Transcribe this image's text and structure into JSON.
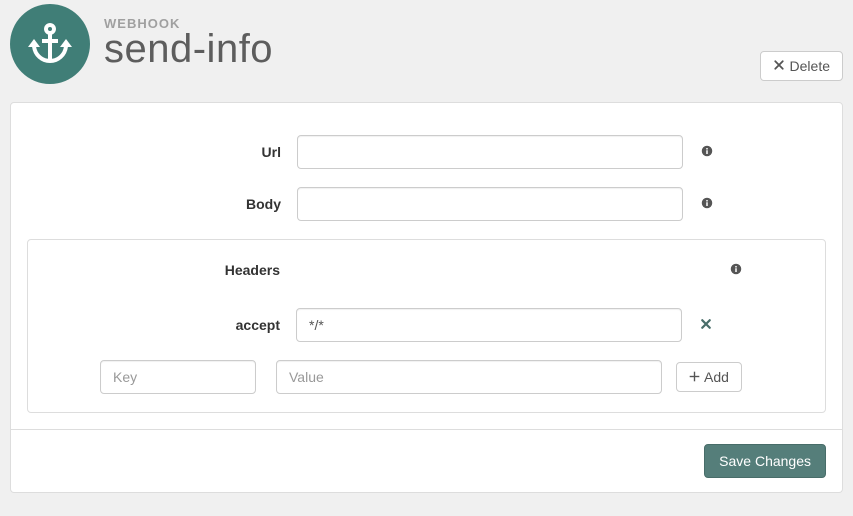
{
  "header": {
    "type_label": "WEBHOOK",
    "title": "send-info",
    "delete_label": "Delete"
  },
  "form": {
    "url": {
      "label": "Url",
      "value": ""
    },
    "body": {
      "label": "Body",
      "value": ""
    }
  },
  "headers": {
    "section_label": "Headers",
    "rows": [
      {
        "key_label": "accept",
        "value": "*/*"
      }
    ],
    "new_row": {
      "key_placeholder": "Key",
      "value_placeholder": "Value"
    },
    "add_label": "Add"
  },
  "footer": {
    "save_label": "Save Changes"
  }
}
